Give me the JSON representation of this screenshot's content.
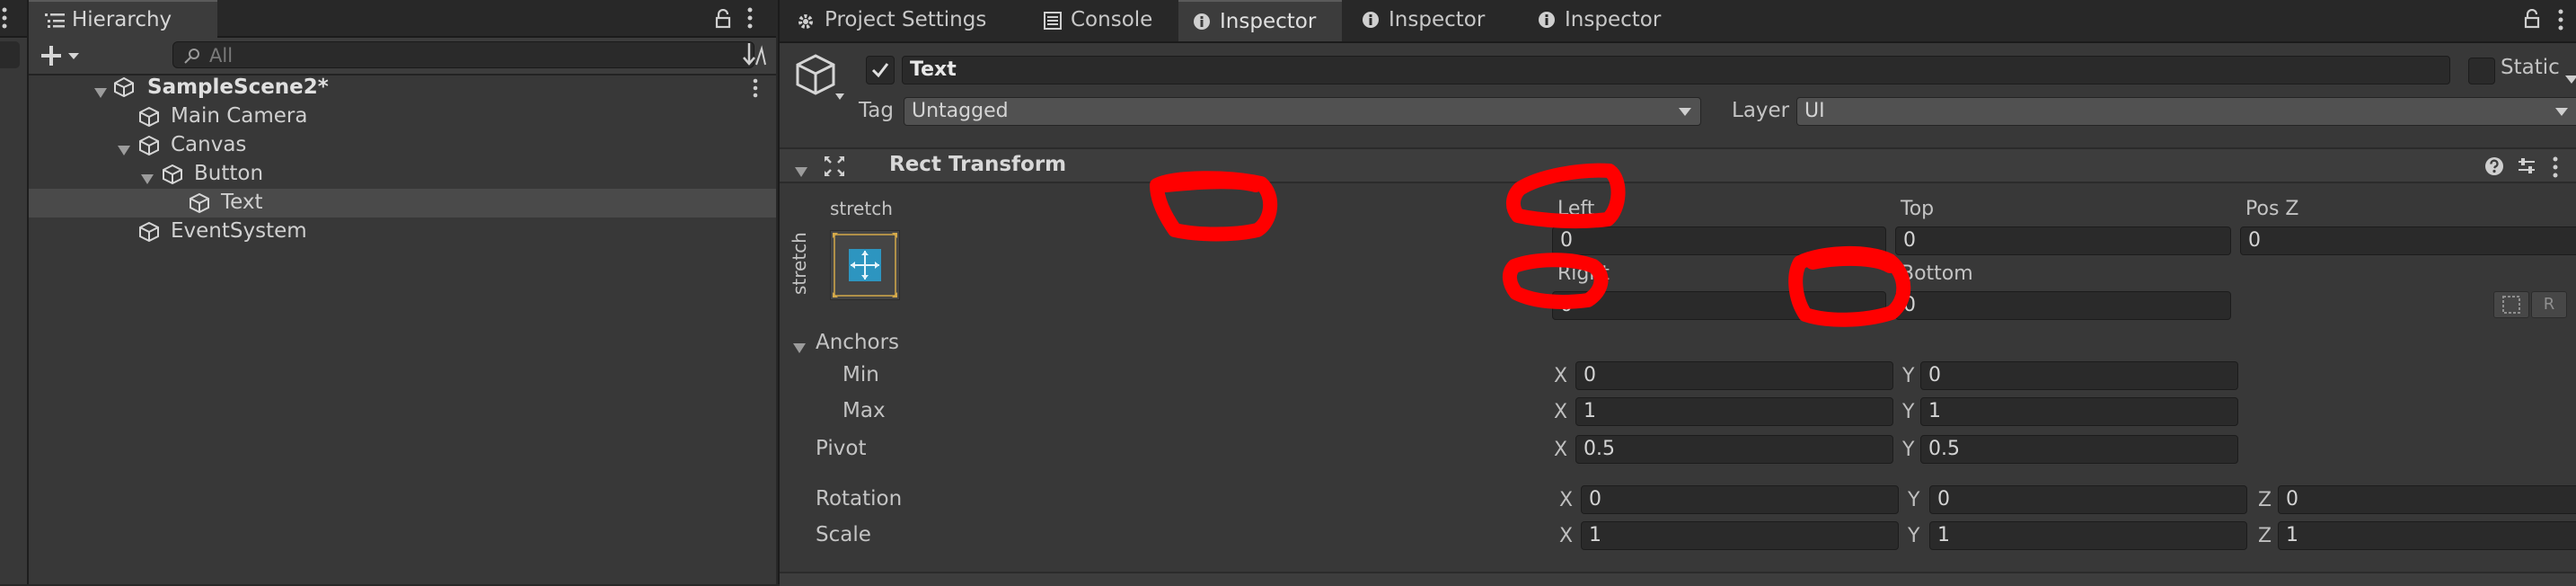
{
  "hierarchy": {
    "tab_label": "Hierarchy",
    "search_placeholder": "All",
    "items": [
      {
        "label": "SampleScene2*"
      },
      {
        "label": "Main Camera"
      },
      {
        "label": "Canvas"
      },
      {
        "label": "Button"
      },
      {
        "label": "Text"
      },
      {
        "label": "EventSystem"
      }
    ]
  },
  "inspector": {
    "tabs": [
      {
        "label": "Project Settings"
      },
      {
        "label": "Console"
      },
      {
        "label": "Inspector"
      },
      {
        "label": "Inspector"
      },
      {
        "label": "Inspector"
      }
    ],
    "object_name": "Text",
    "static_label": "Static",
    "tag_label": "Tag",
    "tag_value": "Untagged",
    "layer_label": "Layer",
    "layer_value": "UI",
    "component_title": "Rect Transform",
    "anchor_preset": {
      "top": "stretch",
      "side": "stretch"
    },
    "offsets": {
      "left_label": "Left",
      "left_value": "0",
      "top_label": "Top",
      "top_value": "0",
      "posz_label": "Pos Z",
      "posz_value": "0",
      "right_label": "Right",
      "right_value": "0",
      "bottom_label": "Bottom",
      "bottom_value": "0"
    },
    "anchors": {
      "label": "Anchors",
      "min_label": "Min",
      "min_x": "0",
      "min_y": "0",
      "max_label": "Max",
      "max_x": "1",
      "max_y": "1"
    },
    "pivot": {
      "label": "Pivot",
      "x": "0.5",
      "y": "0.5"
    },
    "rotation": {
      "label": "Rotation",
      "x": "0",
      "y": "0",
      "z": "0"
    },
    "scale": {
      "label": "Scale",
      "x": "1",
      "y": "1",
      "z": "1"
    },
    "axis": {
      "x": "X",
      "y": "Y",
      "z": "Z"
    },
    "raw_button": "R"
  },
  "colors": {
    "annotation": "#ff0000",
    "selection": "#4a4a4a",
    "anchor_accent": "#29a3d6"
  }
}
